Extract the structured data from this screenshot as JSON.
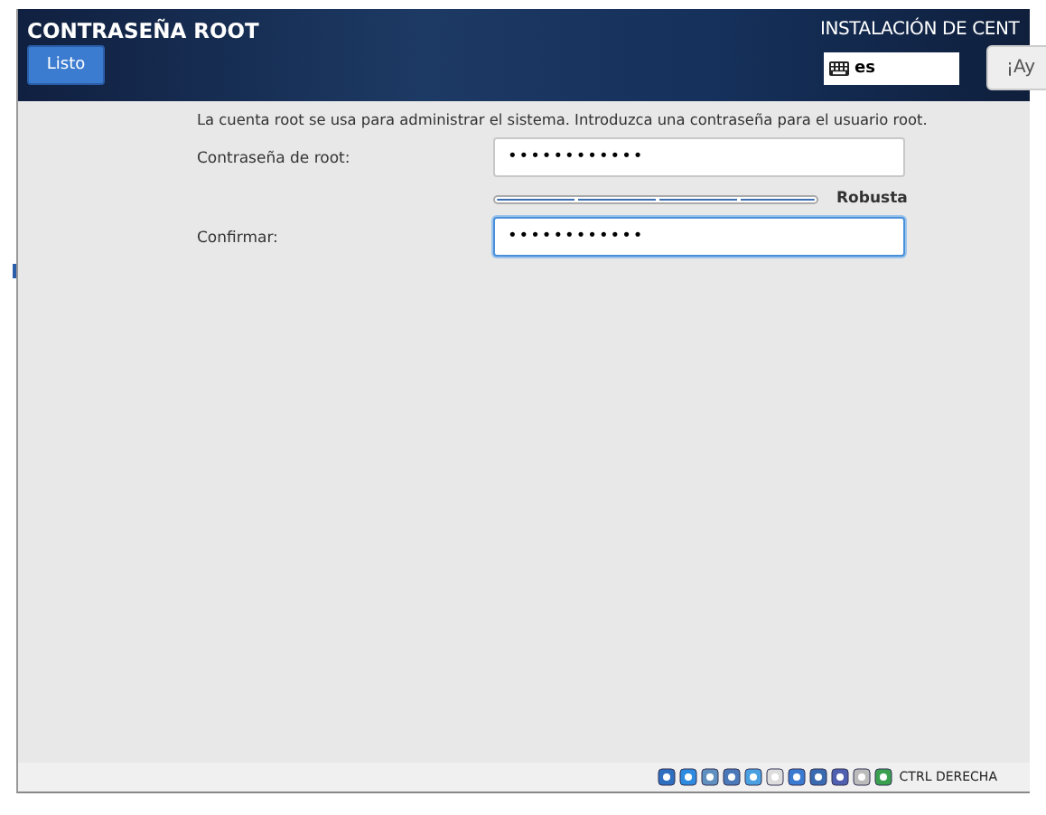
{
  "header": {
    "title": "CONTRASEÑA ROOT",
    "done_button": "Listo",
    "install_title": "INSTALACIÓN DE CENT",
    "keyboard_layout": "es",
    "help_button": "¡Ay"
  },
  "form": {
    "description": "La cuenta root se usa para administrar el sistema. Introduzca una contraseña para el usuario root.",
    "fields": [
      {
        "label": "Contraseña de root:",
        "value": "••••••••••••",
        "focused": false
      },
      {
        "label": "Confirmar:",
        "value": "••••••••••••",
        "focused": true
      }
    ],
    "strength": {
      "level": 1,
      "label": "Robusta"
    }
  },
  "status_bar": {
    "host_key": "CTRL DERECHA"
  }
}
